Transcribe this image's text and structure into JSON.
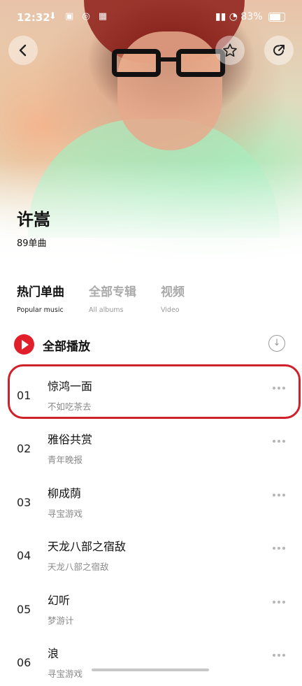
{
  "status_bar": {
    "time": "12:32",
    "battery": "83%"
  },
  "header": {
    "back_icon": "chevron-left-icon",
    "favorite_icon": "star-icon",
    "share_icon": "share-icon"
  },
  "artist": {
    "name": "许嵩",
    "song_count": "89单曲"
  },
  "tabs": [
    {
      "label": "热门单曲",
      "sublabel": "Popular music",
      "active": true
    },
    {
      "label": "全部专辑",
      "sublabel": "All albums",
      "active": false
    },
    {
      "label": "视频",
      "sublabel": "Video",
      "active": false
    }
  ],
  "play_all": {
    "label": "全部播放",
    "accent": "#e01f2a"
  },
  "songs": [
    {
      "num": "01",
      "title": "惊鸿一面",
      "album": "不如吃茶去"
    },
    {
      "num": "02",
      "title": "雅俗共赏",
      "album": "青年晚报"
    },
    {
      "num": "03",
      "title": "柳成荫",
      "album": "寻宝游戏"
    },
    {
      "num": "04",
      "title": "天龙八部之宿敌",
      "album": "天龙八部之宿敌"
    },
    {
      "num": "05",
      "title": "幻听",
      "album": "梦游计"
    },
    {
      "num": "06",
      "title": "浪",
      "album": "寻宝游戏"
    }
  ],
  "highlight_color": "#d0202a"
}
